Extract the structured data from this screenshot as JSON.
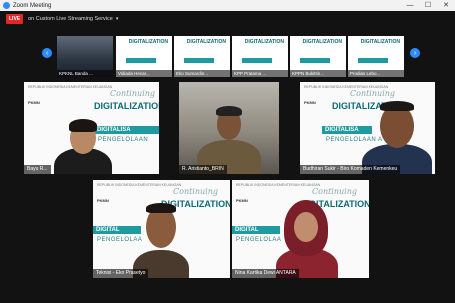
{
  "window": {
    "title": "Zoom Meeting",
    "minimize": "—",
    "maximize": "☐",
    "close": "✕"
  },
  "topbar": {
    "live": "LIVE",
    "stream_label": "on Custom Live Streaming Service",
    "caret": "▾"
  },
  "gallery": {
    "prev": "‹",
    "next": "›",
    "thumbs": [
      {
        "name": "KPKNL Banda ..."
      },
      {
        "name": "Vidiada Hecar...",
        "title": "DIGITALIZATION"
      },
      {
        "name": "Eko Sumardin...",
        "title": "DIGITALIZATION"
      },
      {
        "name": "KPP Pratama ...",
        "title": "DIGITALIZATION"
      },
      {
        "name": "KPPN Bukittin...",
        "title": "DIGITALIZATION"
      },
      {
        "name": "Prodias Lebo...",
        "title": "DIGITALIZATION"
      }
    ]
  },
  "tiles": [
    {
      "name": "Bayu R...",
      "cont": "Continuing",
      "dig": "DIGITALIZATION",
      "band": "DIGITALISA",
      "sub": "PENGELOLAAN"
    },
    {
      "name": "R. Aristianto_BRIN"
    },
    {
      "name": "Budhiran Sukir - Biro Komaden Kemenkeu",
      "cont": "Continuing",
      "dig": "DIGITALIZATION",
      "band": "DIGITALISA",
      "sub": "PENGELOLAAN A"
    },
    {
      "name": "Teknisi - Eko Prasetyo",
      "cont": "Continuing",
      "dig": "DIGITALIZATION",
      "band": "DIGITAL",
      "sub": "PENGELOLAA"
    },
    {
      "name": "Nina Kartika Dewi ANTARA",
      "cont": "Continuing",
      "dig": "DIGITALIZATION",
      "band": "DIGITAL",
      "sub": "PENGELOLAA"
    }
  ],
  "slide_header": "REPUBLIK INDONESIA KEMENTERIAN KEUANGAN",
  "slide_logos": "PKMN",
  "colors": {
    "accent": "#1f9aa0",
    "live": "#e02828",
    "zoom_blue": "#2d8cff",
    "speaker_highlight": "#f3e12a"
  }
}
